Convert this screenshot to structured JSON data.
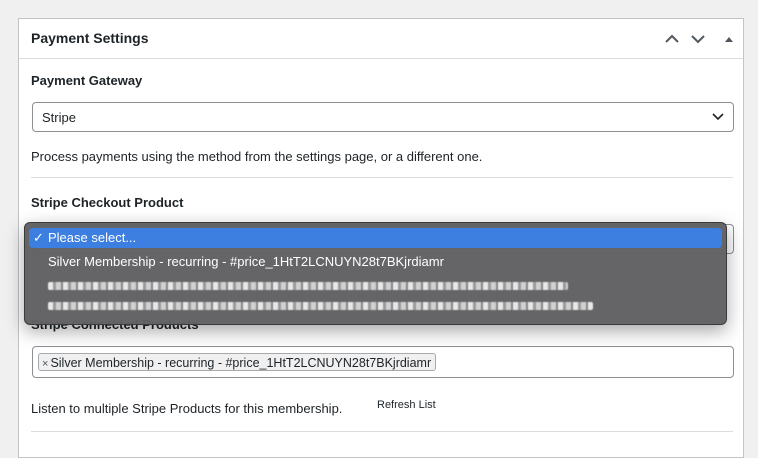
{
  "panel": {
    "title": "Payment Settings",
    "header_buttons": [
      "chevron-up-icon",
      "chevron-down-icon",
      "toggle-triangle-icon"
    ]
  },
  "gateway": {
    "label": "Payment Gateway",
    "selected": "Stripe",
    "help": "Process payments using the method from the settings page, or a different one."
  },
  "checkout_product": {
    "label": "Stripe Checkout Product",
    "options": [
      {
        "label": "Please select...",
        "selected": true
      },
      {
        "label": "Silver Membership - recurring - #price_1HtT2LCNUYN28t7BKjrdiamr",
        "selected": false
      },
      {
        "label": "",
        "selected": false,
        "redacted": true
      },
      {
        "label": "",
        "selected": false,
        "redacted": true
      }
    ]
  },
  "connected_products": {
    "label": "Stripe Connected Products",
    "chip": "Silver Membership - recurring - #price_1HtT2LCNUYN28t7BKjrdiamr",
    "chip_remove": "×",
    "help": "Listen to multiple Stripe Products for this membership.",
    "refresh": "Refresh List"
  },
  "colors": {
    "accent": "#3d7fe0",
    "popup_bg": "#606062",
    "border": "#8c8f94"
  }
}
